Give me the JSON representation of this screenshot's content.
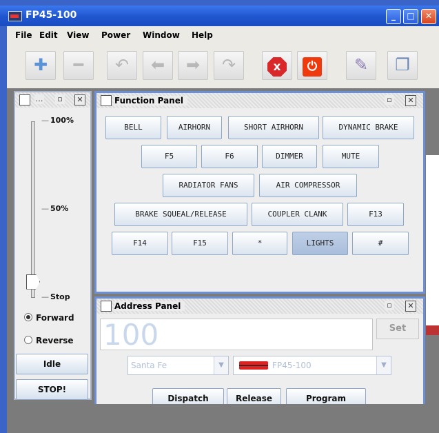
{
  "window": {
    "title": "FP45-100"
  },
  "menubar": {
    "items": [
      "File",
      "Edit",
      "View",
      "Power",
      "Window",
      "Help"
    ]
  },
  "toolbar": {
    "add_icon": "plus-icon",
    "remove_icon": "minus-icon",
    "stop_icon": "x",
    "power_icon": "power-icon"
  },
  "throttle": {
    "ticks": [
      "100%",
      "50%",
      "Stop"
    ],
    "speed_fraction": 0.08,
    "direction": {
      "forward": "Forward",
      "reverse": "Reverse",
      "selected": "Forward"
    },
    "idle_label": "Idle",
    "stop_label": "STOP!"
  },
  "function_panel": {
    "title": "Function Panel",
    "buttons": [
      "BELL",
      "AIRHORN",
      "SHORT AIRHORN",
      "DYNAMIC BRAKE",
      "F5",
      "F6",
      "DIMMER",
      "MUTE",
      "RADIATOR FANS",
      "AIR COMPRESSOR",
      "BRAKE SQUEAL/RELEASE",
      "COUPLER CLANK",
      "F13",
      "F14",
      "F15",
      "*",
      "LIGHTS",
      "#"
    ],
    "pressed": "LIGHTS"
  },
  "address_panel": {
    "title": "Address Panel",
    "address_value": "100",
    "set_label": "Set",
    "roster_railroad": "Santa Fe",
    "roster_loco": "FP45-100",
    "dispatch_label": "Dispatch",
    "release_label": "Release",
    "program_label": "Program"
  }
}
